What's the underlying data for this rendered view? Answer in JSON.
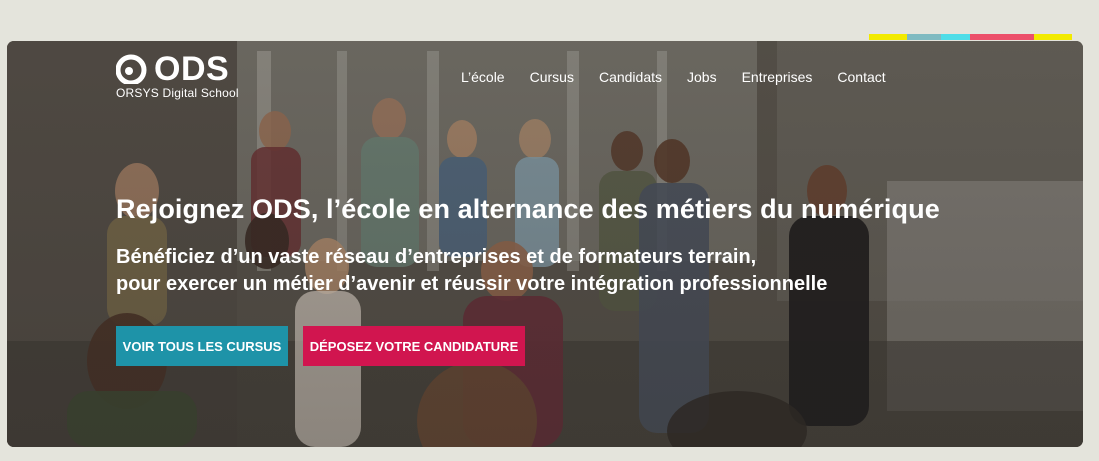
{
  "brand": {
    "logo_text": "ODS",
    "logo_subtitle": "ORSYS Digital School"
  },
  "nav": {
    "items": [
      "L’école",
      "Cursus",
      "Candidats",
      "Jobs",
      "Entreprises",
      "Contact"
    ]
  },
  "hero": {
    "headline": "Rejoignez ODS, l’école en alternance des métiers du numérique",
    "subline_1": "Bénéficiez d’un vaste réseau d’entreprises et de formateurs terrain,",
    "subline_2": "pour exercer un métier d’avenir et réussir votre intégration professionnelle",
    "cta_primary": "VOIR TOUS LES CURSUS",
    "cta_secondary": "DÉPOSEZ VOTRE CANDIDATURE"
  },
  "colors": {
    "strip": [
      "#f2ea00",
      "#7fbac1",
      "#4fdde8",
      "#ec4f6a",
      "#f2ea00"
    ],
    "primary_button": "#1e93a8",
    "secondary_button": "#d1154f"
  }
}
